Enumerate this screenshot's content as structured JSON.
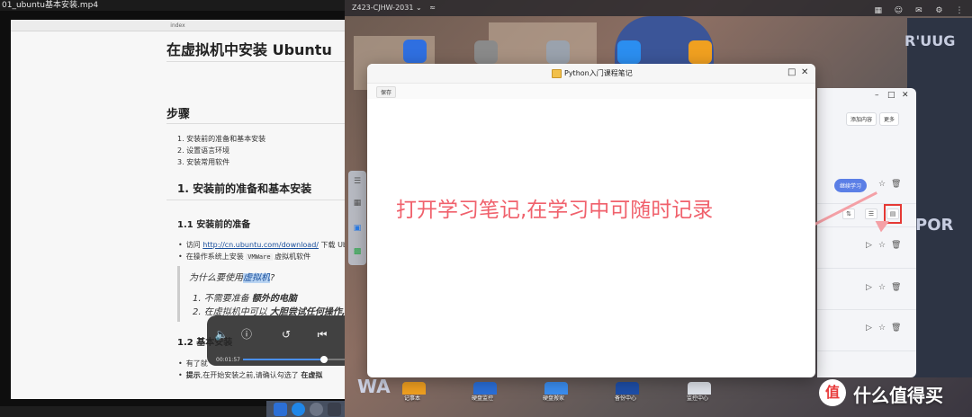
{
  "video": {
    "filename": "01_ubuntu基本安装.mp4",
    "doc_tab": "index",
    "h1": "在虚拟机中安装 Ubuntu",
    "steps_heading": "步骤",
    "steps": [
      "1. 安装前的准备和基本安装",
      "2. 设置语言环境",
      "3. 安装常用软件"
    ],
    "section1": "1. 安装前的准备和基本安装",
    "sub11": "1.1 安装前的准备",
    "bullet1_prefix": "访问 ",
    "bullet1_link": "http://cn.ubuntu.com/download/",
    "bullet1_suffix": " 下载 Ubu",
    "bullet2_prefix": "在操作系统上安装 ",
    "bullet2_code": "VMWare",
    "bullet2_suffix": " 虚拟机软件",
    "quote_prefix": "为什么要使用",
    "quote_highlight": "虚拟机",
    "quote_suffix": "?",
    "quote_item1_prefix": "1.  不需要准备 ",
    "quote_item1_bold": "额外的电脑",
    "quote_item2_prefix": "2.  在虚拟机中可以 ",
    "quote_item2_bold": "大胆尝试任何操作,",
    "sub12": "1.2 基本安装",
    "bullet3": "有了就",
    "bullet4_bold": "提示",
    "bullet4_text": ",在开始安装之前,请确认勾选了 ",
    "bullet4_bold2": "在虚拟",
    "time_current": "00:01:57",
    "progress": 0.8
  },
  "nas": {
    "device_name": "Z423-CJHW-2031",
    "apps_top": [
      {
        "name": "folder-icon",
        "color": "#2f6fe0"
      },
      {
        "name": "disk-icon",
        "color": "#8a8a8a"
      },
      {
        "name": "trash-icon",
        "color": "#9aa2ad"
      },
      {
        "name": "sync-icon",
        "color": "#2b8ef0"
      },
      {
        "name": "help-icon",
        "color": "#f0a020"
      }
    ],
    "bottom_apps": [
      "记事本",
      "硬盘监控",
      "硬盘搬家",
      "备份中心",
      "监控中心"
    ],
    "bg_window": {
      "add_content": "添加内容",
      "more": "更多",
      "continue_btn": "继续学习"
    },
    "wall_texts": [
      "R'UUG",
      "POR",
      "WA"
    ]
  },
  "notes": {
    "title": "Python入门课程笔记",
    "save_label": "保存",
    "caption": "打开学习笔记,在学习中可随时记录"
  },
  "watermark": {
    "logo_char": "值",
    "text": "什么值得买"
  }
}
